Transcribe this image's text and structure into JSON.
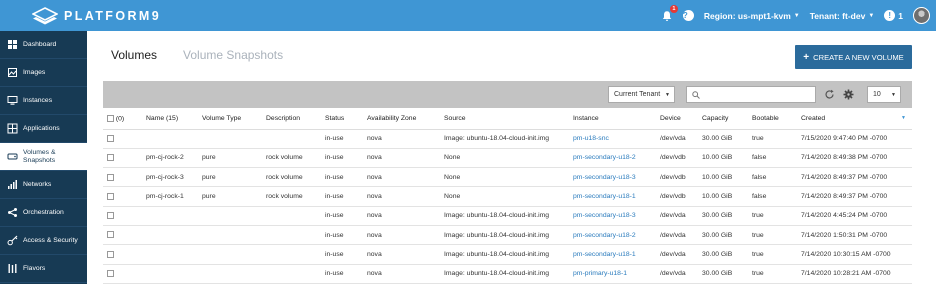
{
  "brand": {
    "name": "PLATFORM9"
  },
  "header": {
    "notifications_count": "1",
    "region_label": "Region: us-mpt1-kvm",
    "tenant_label": "Tenant: ft-dev",
    "alerts_count": "1"
  },
  "sidebar": {
    "items": [
      {
        "label": "Dashboard",
        "icon": "dashboard-icon"
      },
      {
        "label": "Images",
        "icon": "images-icon"
      },
      {
        "label": "Instances",
        "icon": "instances-icon"
      },
      {
        "label": "Applications",
        "icon": "applications-icon"
      },
      {
        "label": "Volumes & Snapshots",
        "icon": "volumes-icon",
        "active": true
      },
      {
        "label": "Networks",
        "icon": "networks-icon"
      },
      {
        "label": "Orchestration",
        "icon": "orchestration-icon"
      },
      {
        "label": "Access & Security",
        "icon": "key-icon"
      },
      {
        "label": "Flavors",
        "icon": "flavors-icon"
      }
    ]
  },
  "main": {
    "tabs": [
      {
        "label": "Volumes",
        "active": true
      },
      {
        "label": "Volume Snapshots",
        "active": false
      }
    ],
    "create_button": "CREATE A NEW VOLUME",
    "tenant_filter": "Current Tenant",
    "search_placeholder": "",
    "page_size": "10"
  },
  "table": {
    "columns": [
      "(0)",
      "Name (15)",
      "Volume Type",
      "Description",
      "Status",
      "Availability Zone",
      "Source",
      "Instance",
      "Device",
      "Capacity",
      "Bootable",
      "Created"
    ],
    "rows": [
      [
        "",
        "",
        "",
        "in-use",
        "nova",
        "Image: ubuntu-18.04-cloud-init.img",
        "pm-u18-snc",
        "/dev/vda",
        "30.00 GiB",
        "true",
        "7/15/2020 9:47:40 PM -0700"
      ],
      [
        "pm-cj-rock-2",
        "pure",
        "rock volume",
        "in-use",
        "nova",
        "None",
        "pm-secondary-u18-2",
        "/dev/vdb",
        "10.00 GiB",
        "false",
        "7/14/2020 8:49:38 PM -0700"
      ],
      [
        "pm-cj-rock-3",
        "pure",
        "rock volume",
        "in-use",
        "nova",
        "None",
        "pm-secondary-u18-3",
        "/dev/vdb",
        "10.00 GiB",
        "false",
        "7/14/2020 8:49:37 PM -0700"
      ],
      [
        "pm-cj-rock-1",
        "pure",
        "rock volume",
        "in-use",
        "nova",
        "None",
        "pm-secondary-u18-1",
        "/dev/vdb",
        "10.00 GiB",
        "false",
        "7/14/2020 8:49:37 PM -0700"
      ],
      [
        "",
        "",
        "",
        "in-use",
        "nova",
        "Image: ubuntu-18.04-cloud-init.img",
        "pm-secondary-u18-3",
        "/dev/vda",
        "30.00 GiB",
        "true",
        "7/14/2020 4:45:24 PM -0700"
      ],
      [
        "",
        "",
        "",
        "in-use",
        "nova",
        "Image: ubuntu-18.04-cloud-init.img",
        "pm-secondary-u18-2",
        "/dev/vda",
        "30.00 GiB",
        "true",
        "7/14/2020 1:50:31 PM -0700"
      ],
      [
        "",
        "",
        "",
        "in-use",
        "nova",
        "Image: ubuntu-18.04-cloud-init.img",
        "pm-secondary-u18-1",
        "/dev/vda",
        "30.00 GiB",
        "true",
        "7/14/2020 10:30:15 AM -0700"
      ],
      [
        "",
        "",
        "",
        "in-use",
        "nova",
        "Image: ubuntu-18.04-cloud-init.img",
        "pm-primary-u18-1",
        "/dev/vda",
        "30.00 GiB",
        "true",
        "7/14/2020 10:28:21 AM -0700"
      ]
    ]
  }
}
